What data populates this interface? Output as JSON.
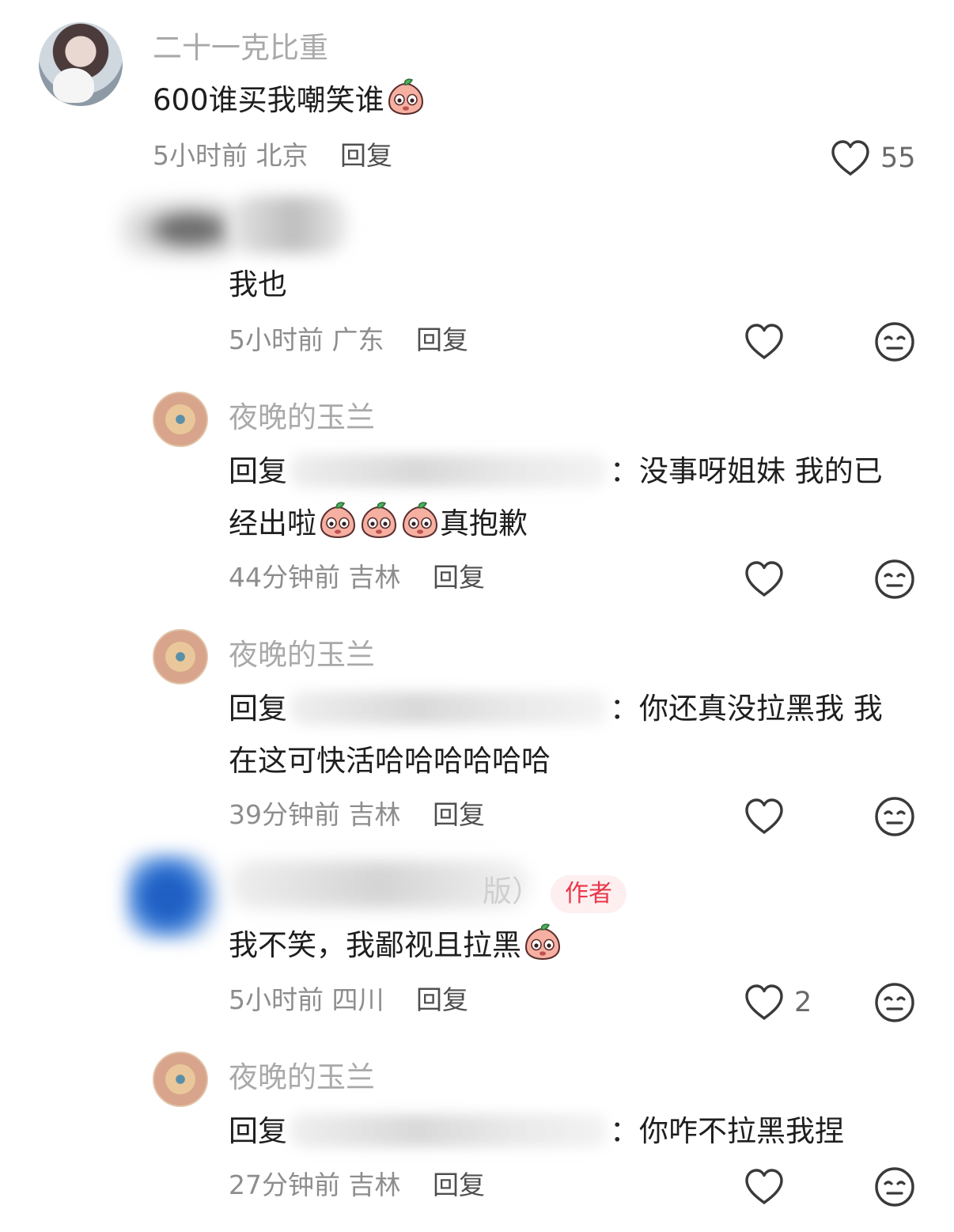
{
  "comments": [
    {
      "author": "二十一克比重",
      "text": "600谁买我嘲笑谁",
      "time": "5小时前",
      "location": "北京",
      "reply_label": "回复",
      "likes": "55",
      "emoji": "sweat-face"
    },
    {
      "author": "",
      "text": "我也",
      "time": "5小时前",
      "location": "广东",
      "reply_label": "回复",
      "emoji": ""
    },
    {
      "author": "夜晚的玉兰",
      "reply_prefix": "回复",
      "text_line1": "：没事呀姐妹 我的已",
      "text_line2_a": "经出啦",
      "text_line2_b": "真抱歉",
      "time": "44分钟前",
      "location": "吉林",
      "reply_label": "回复",
      "emoji": "hand-over-mouth-face"
    },
    {
      "author": "夜晚的玉兰",
      "reply_prefix": "回复",
      "text_line1": "：你还真没拉黑我 我",
      "text_line2": "在这可快活哈哈哈哈哈哈",
      "time": "39分钟前",
      "location": "吉林",
      "reply_label": "回复"
    },
    {
      "author_tail": "版）",
      "badge": "作者",
      "text": "我不笑，我鄙视且拉黑",
      "time": "5小时前",
      "location": "四川",
      "reply_label": "回复",
      "likes": "2",
      "emoji": "crying-laughing-face"
    },
    {
      "author": "夜晚的玉兰",
      "reply_prefix": "回复",
      "text_line1": "：你咋不拉黑我捏",
      "time": "27分钟前",
      "location": "吉林",
      "reply_label": "回复"
    }
  ],
  "icons": {
    "like": "heart-outline-icon",
    "dislike": "meh-face-icon"
  },
  "colors": {
    "author_name": "#a9a9a9",
    "author_badge_text": "#e8384a",
    "author_badge_bg": "#fdeff0"
  }
}
